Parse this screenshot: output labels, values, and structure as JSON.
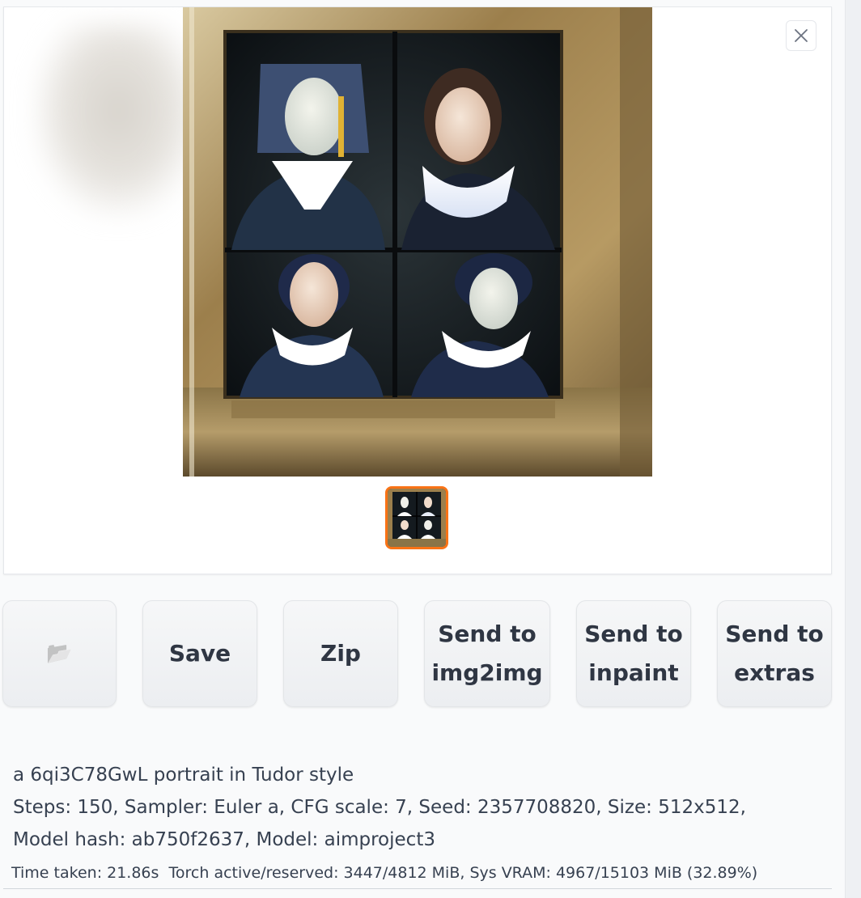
{
  "gallery": {
    "close_icon": "close-icon",
    "selected_index": 0
  },
  "actions": {
    "folder_icon": "folder-icon",
    "folder_glyph": "📂",
    "save_label": "Save",
    "zip_label": "Zip",
    "send_img2img_label": "Send to\nimg2img",
    "send_inpaint_label": "Send to\ninpaint",
    "send_extras_label": "Send to\nextras"
  },
  "generation_info": {
    "prompt": "a 6qi3C78GwL portrait in Tudor style",
    "params": "Steps: 150, Sampler: Euler a, CFG scale: 7, Seed: 2357708820, Size: 512x512, Model hash: ab750f2637, Model: aimproject3"
  },
  "performance": {
    "time_taken": "Time taken: 21.86s",
    "torch_memory": "Torch active/reserved: 3447/4812 MiB, Sys VRAM: 4967/15103 MiB (32.89%)"
  },
  "colors": {
    "selection_accent": "#f97316",
    "button_text": "#2f3643"
  }
}
